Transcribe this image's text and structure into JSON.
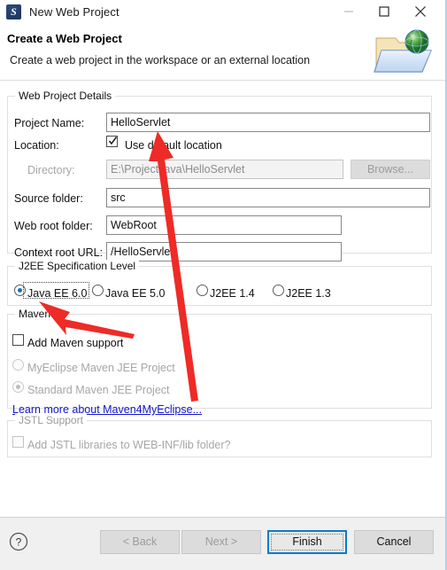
{
  "window": {
    "title": "New Web Project",
    "icon": "myeclipse-app-icon",
    "controls": {
      "minimize": "minimize-icon",
      "maximize": "maximize-icon",
      "close": "close-icon"
    }
  },
  "header": {
    "title": "Create a Web Project",
    "description": "Create a web project in the workspace or an external location",
    "graphic": "folder-globe-icon"
  },
  "details": {
    "group_label": "Web Project Details",
    "project_name": {
      "label": "Project Name:",
      "value": "HelloServlet",
      "placeholder": ""
    },
    "location": {
      "label": "Location:",
      "use_default_label": "Use default location",
      "use_default_checked": true
    },
    "directory": {
      "label": "Directory:",
      "value": "E:\\Project\\java\\HelloServlet",
      "enabled": false,
      "browse_label": "Browse...",
      "browse_enabled": false
    },
    "source_folder": {
      "label": "Source folder:",
      "value": "src"
    },
    "web_root_folder": {
      "label": "Web root folder:",
      "value": "WebRoot"
    },
    "context_root_url": {
      "label": "Context root URL:",
      "value": "/HelloServlet"
    }
  },
  "j2ee": {
    "group_label": "J2EE Specification Level",
    "options": [
      {
        "label": "Java EE 6.0",
        "selected": true
      },
      {
        "label": "Java EE 5.0",
        "selected": false
      },
      {
        "label": "J2EE 1.4",
        "selected": false
      },
      {
        "label": "J2EE 1.3",
        "selected": false
      }
    ]
  },
  "maven": {
    "group_label": "Maven",
    "add_support": {
      "label": "Add Maven support",
      "checked": false,
      "mnemonic": "M"
    },
    "options": [
      {
        "label": "MyEclipse Maven JEE Project",
        "selected": false,
        "enabled": false
      },
      {
        "label": "Standard Maven JEE Project",
        "selected": true,
        "enabled": false
      }
    ],
    "link": "Learn more about Maven4MyEclipse..."
  },
  "jstl": {
    "group_label": "JSTL Support",
    "checkbox": {
      "label": "Add JSTL libraries to WEB-INF/lib folder?",
      "checked": false,
      "enabled": false
    }
  },
  "footer": {
    "help": "help-icon",
    "back": {
      "label": "< Back",
      "enabled": false
    },
    "next": {
      "label": "Next >",
      "enabled": false
    },
    "finish": {
      "label": "Finish",
      "enabled": true,
      "is_default": true
    },
    "cancel": {
      "label": "Cancel",
      "enabled": true
    }
  },
  "annotations": {
    "accent_color": "#ee2b26",
    "arrows": [
      {
        "name": "arrow-to-project-name",
        "points_to": "project-name-input"
      },
      {
        "name": "arrow-to-java-ee-6",
        "points_to": "radio-java-ee-60"
      }
    ]
  },
  "colors": {
    "default_button_border": "#0d7ac9",
    "link": "#1414cf",
    "radio_dot": "#1073c6"
  }
}
